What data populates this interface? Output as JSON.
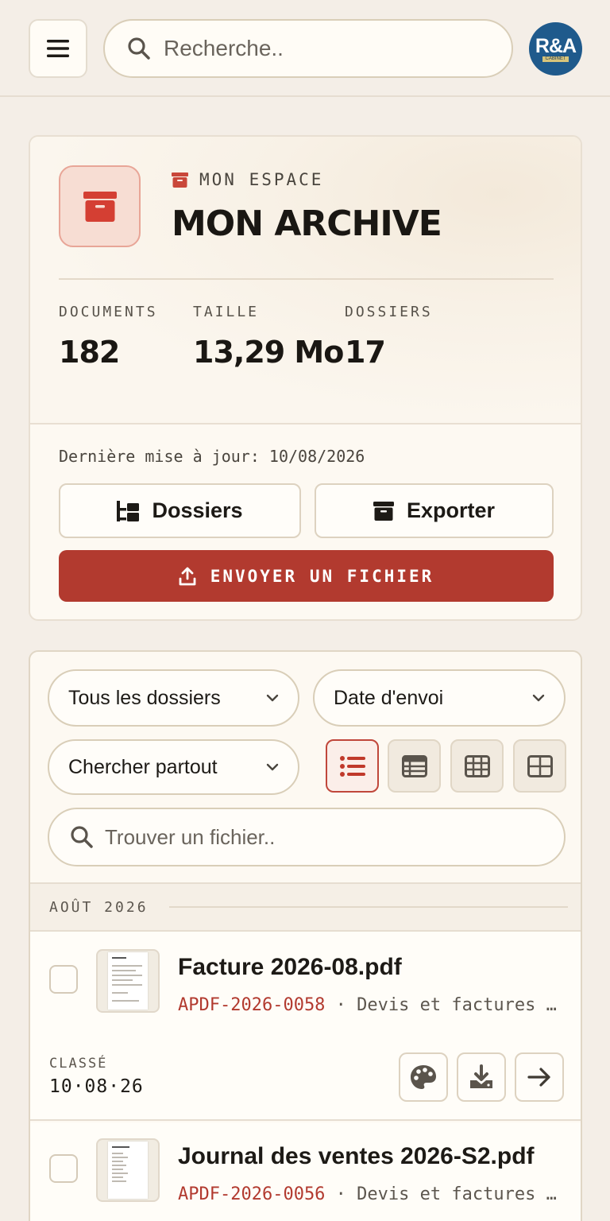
{
  "topbar": {
    "search_placeholder": "Recherche..",
    "avatar_text": "R&A",
    "avatar_sub": "CABINET"
  },
  "archive": {
    "eyebrow": "MON ESPACE",
    "title": "MON ARCHIVE",
    "stats": [
      {
        "label": "DOCUMENTS",
        "value": "182"
      },
      {
        "label": "TAILLE",
        "value": "13,29 Mo"
      },
      {
        "label": "DOSSIERS",
        "value": "17"
      }
    ],
    "updated": "Dernière mise à jour: 10/08/2026",
    "btn_folders": "Dossiers",
    "btn_export": "Exporter",
    "btn_upload": "ENVOYER UN FICHIER"
  },
  "filters": {
    "folder_select": "Tous les dossiers",
    "sort_select": "Date d'envoi",
    "scope_select": "Chercher partout",
    "file_search_placeholder": "Trouver un fichier..",
    "active_view": "list"
  },
  "groups": [
    {
      "month": "AOÛT 2026",
      "files": [
        {
          "name": "Facture 2026-08.pdf",
          "ref": "APDF-2026-0058",
          "folder": " · Devis et factures (clients)",
          "status_label": "CLASSÉ",
          "status_date": "10·08·26"
        },
        {
          "name": "Journal des ventes 2026-S2.pdf",
          "ref": "APDF-2026-0056",
          "folder": " · Devis et factures (clients)"
        }
      ]
    }
  ],
  "colors": {
    "accent": "#b23a2f",
    "background": "#f4eee7",
    "card": "#fdf9f2"
  }
}
